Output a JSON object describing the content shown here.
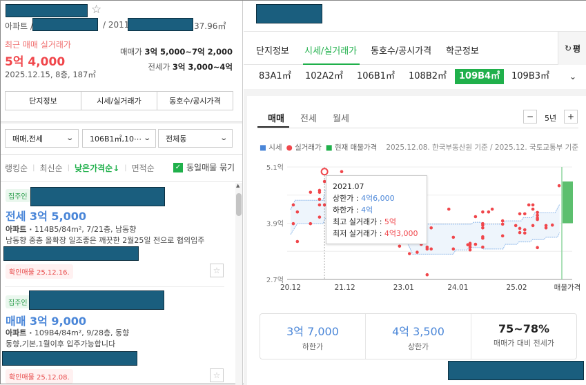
{
  "header": {
    "type_prefix": "아파트 /",
    "year_prefix": "/ 2011.",
    "area_suffix": "37.96㎡"
  },
  "recent": {
    "label": "최근 매매 실거래가",
    "price": "5억 4,000",
    "detail": "2025.12.15, 8층, 187㎡"
  },
  "ranges": {
    "sale_label": "매매가",
    "sale": "3억 5,000~7억 2,000",
    "jeonse_label": "전세가",
    "jeonse": "3억 3,000~4억"
  },
  "left_buttons": [
    "단지정보",
    "시세/실거래가",
    "동호수/공시가격"
  ],
  "filters": [
    "매매,전세",
    "106B1㎡,10⋯",
    "전체동"
  ],
  "sort": {
    "items": [
      "랭킹순",
      "최신순",
      "낮은가격순↓",
      "면적순"
    ],
    "active": 2,
    "group_label": "동일매물 묶기"
  },
  "listings": [
    {
      "badge": "집주인",
      "price": "전세 3억 5,000",
      "type": "아파트 ·",
      "spec": "114B5/84m², 7/21층, 남동향",
      "desc": "남동향 중층 올확장 일조좋은 깨끗한 2월25일 전으로 협의입주",
      "confirm": "확인매물 25.12.16."
    },
    {
      "badge": "집주인",
      "price": "매매 3억 9,000",
      "type": "아파트 ·",
      "spec": "109B4/84m², 9/28층, 동향",
      "desc": "동향,기본,1월이후 입주가능합니다",
      "confirm": "확인매물 25.12.08."
    }
  ],
  "right_tabs": [
    "단지정보",
    "시세/실거래가",
    "동호수/공시가격",
    "학군정보"
  ],
  "right_tab_active": 1,
  "unit_toggle": "평",
  "areas": [
    "83A1㎡",
    "102A2㎡",
    "106B1㎡",
    "108B2㎡",
    "109B4㎡",
    "109B3㎡"
  ],
  "area_active": 4,
  "deal_tabs": [
    "매매",
    "전세",
    "월세"
  ],
  "period": "5년",
  "legend": {
    "market": "시세",
    "actual": "실거래가",
    "listing": "현재 매물가격",
    "source": "2025.12.08. 한국부동산원 기준 / 2025.12. 국토교통부 기준"
  },
  "tooltip": {
    "date": "2021.07",
    "upper_label": "상한가 :",
    "upper": "4억6,000",
    "lower_label": "하한가 :",
    "lower": "4억",
    "max_label": "최고 실거래가 :",
    "max": "5억",
    "min_label": "최저 실거래가 :",
    "min": "4억3,000"
  },
  "summary": [
    {
      "value": "3억 7,000",
      "label": "하한가"
    },
    {
      "value": "4억 3,500",
      "label": "상한가"
    },
    {
      "value": "75~78%",
      "label": "매매가 대비 전세가"
    }
  ],
  "colors": {
    "accent": "#20b04b",
    "red": "#f0464b",
    "blue": "#4a86d8"
  },
  "chart_data": {
    "type": "scatter",
    "title": "",
    "xlabel": "",
    "ylabel": "",
    "x_unit": "months since 2020.12",
    "xticks": [
      {
        "m": 0,
        "label": "20.12"
      },
      {
        "m": 12,
        "label": "21.12"
      },
      {
        "m": 25,
        "label": "23.01"
      },
      {
        "m": 37,
        "label": "24.01"
      },
      {
        "m": 50,
        "label": "25.02"
      },
      {
        "m": 60,
        "label": "매물가격"
      }
    ],
    "yticks": [
      {
        "v": 5.1,
        "label": "5.1억"
      },
      {
        "v": 3.9,
        "label": "3.9억"
      },
      {
        "v": 2.7,
        "label": "2.7억"
      }
    ],
    "ylim": [
      2.7,
      5.1
    ],
    "xlim": [
      0,
      60
    ],
    "grid": true,
    "market_upper": [
      [
        0,
        4.19
      ],
      [
        1,
        4.39
      ],
      [
        7.2,
        4.39
      ],
      [
        7.6,
        4.6
      ],
      [
        12,
        4.6
      ],
      [
        16,
        4.45
      ],
      [
        20,
        4.25
      ],
      [
        24,
        4.05
      ],
      [
        27,
        3.88
      ],
      [
        40,
        3.88
      ],
      [
        40.5,
        3.92
      ],
      [
        42,
        3.92
      ],
      [
        42.5,
        3.88
      ],
      [
        47,
        3.88
      ],
      [
        47.5,
        3.95
      ],
      [
        51,
        3.95
      ],
      [
        51.5,
        4.02
      ],
      [
        53.5,
        4.02
      ],
      [
        54,
        4.12
      ],
      [
        58.5,
        4.12
      ],
      [
        59.5,
        4.3
      ]
    ],
    "market_lower": [
      [
        0,
        3.66
      ],
      [
        1.5,
        3.89
      ],
      [
        7.2,
        3.89
      ],
      [
        7.6,
        4.0
      ],
      [
        12,
        4.0
      ],
      [
        16,
        3.85
      ],
      [
        20,
        3.7
      ],
      [
        24,
        3.55
      ],
      [
        26,
        3.45
      ],
      [
        27,
        3.24
      ],
      [
        36,
        3.24
      ],
      [
        36.5,
        3.33
      ],
      [
        39,
        3.33
      ],
      [
        39.5,
        3.38
      ],
      [
        42,
        3.38
      ],
      [
        42.5,
        3.35
      ],
      [
        47,
        3.35
      ],
      [
        47.5,
        3.45
      ],
      [
        50,
        3.45
      ],
      [
        50.5,
        3.5
      ],
      [
        53,
        3.5
      ],
      [
        53.5,
        3.55
      ],
      [
        56,
        3.55
      ],
      [
        56.5,
        3.6
      ],
      [
        59,
        3.6
      ],
      [
        59.5,
        3.7
      ]
    ],
    "actual": [
      [
        0.6,
        4.29
      ],
      [
        1.5,
        4.14
      ],
      [
        0.6,
        3.89
      ],
      [
        1.5,
        3.51
      ],
      [
        4.4,
        4.56
      ],
      [
        4.4,
        3.89
      ],
      [
        6.4,
        4.6
      ],
      [
        6.4,
        4.56
      ],
      [
        6.4,
        4.41
      ],
      [
        6.4,
        4.29
      ],
      [
        6.4,
        4.03
      ],
      [
        7.5,
        4.79
      ],
      [
        7.5,
        4.29
      ],
      [
        11.3,
        5.0
      ],
      [
        24.1,
        3.41
      ],
      [
        26.3,
        3.25
      ],
      [
        28,
        3.28
      ],
      [
        28.9,
        3.45
      ],
      [
        30.2,
        3.39
      ],
      [
        30.2,
        3.35
      ],
      [
        30.2,
        2.8
      ],
      [
        31.1,
        3.8
      ],
      [
        31.1,
        3.35
      ],
      [
        35,
        4.2
      ],
      [
        36,
        3.6
      ],
      [
        36,
        3.35
      ],
      [
        39.2,
        3.44
      ],
      [
        39.7,
        3.47
      ],
      [
        39.7,
        3.44
      ],
      [
        39.7,
        3.39
      ],
      [
        39.7,
        3.33
      ],
      [
        40.9,
        4.04
      ],
      [
        40.9,
        3.45
      ],
      [
        42.5,
        4.14
      ],
      [
        42.5,
        3.89
      ],
      [
        42.5,
        3.86
      ],
      [
        42.5,
        3.8
      ],
      [
        42.5,
        3.61
      ],
      [
        42.5,
        3.58
      ],
      [
        42.5,
        3.39
      ],
      [
        43.8,
        4.14
      ],
      [
        44.6,
        4.2
      ],
      [
        46.9,
        3.95
      ],
      [
        46.9,
        3.88
      ],
      [
        46.9,
        3.63
      ],
      [
        49.8,
        3.85
      ],
      [
        50.7,
        4.1
      ],
      [
        50.7,
        3.79
      ],
      [
        50.7,
        3.7
      ],
      [
        51.8,
        4.1
      ],
      [
        51.8,
        3.76
      ],
      [
        51.8,
        3.69
      ],
      [
        52.7,
        4.29
      ],
      [
        53.6,
        4.29
      ],
      [
        53.6,
        4.2
      ],
      [
        53.6,
        3.85
      ],
      [
        54.6,
        4.13
      ],
      [
        54.6,
        4.07
      ],
      [
        54.6,
        4.01
      ],
      [
        54.6,
        3.98
      ],
      [
        54.6,
        3.38
      ],
      [
        56.5,
        3.85
      ],
      [
        56.5,
        3.8
      ],
      [
        57.9,
        3.86
      ],
      [
        59.4,
        4.7
      ]
    ],
    "highlight": [
      7.5,
      5.0
    ],
    "tooltip_at": 7.5,
    "listing_range": [
      3.9,
      4.79
    ]
  }
}
